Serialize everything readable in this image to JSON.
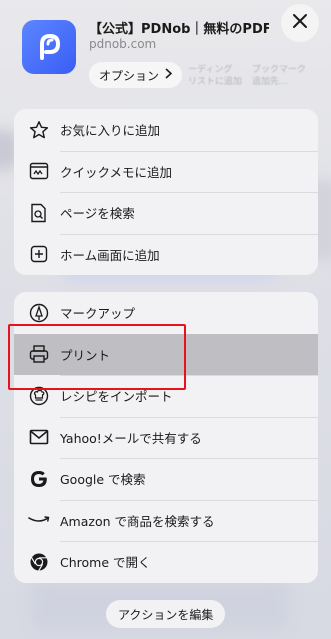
{
  "header": {
    "site_title": "【公式】PDNob｜無料のPDF編…",
    "site_url": "pdnob.com",
    "options_label": "オプション",
    "close_icon": "close-icon",
    "app_icon": "pdnob-app-icon"
  },
  "background_text": {
    "left": "ーディング\nリストに追加",
    "right": "ブックマーク\n追加先..."
  },
  "group1": {
    "items": [
      {
        "label": "お気に入りに追加",
        "icon": "star-icon"
      },
      {
        "label": "クイックメモに追加",
        "icon": "quick-note-icon"
      },
      {
        "label": "ページを検索",
        "icon": "find-on-page-icon"
      },
      {
        "label": "ホーム画面に追加",
        "icon": "add-square-icon"
      }
    ]
  },
  "group2": {
    "items": [
      {
        "label": "マークアップ",
        "icon": "markup-pen-icon"
      },
      {
        "label": "プリント",
        "icon": "printer-icon",
        "selected": true
      },
      {
        "label": "レシピをインポート",
        "icon": "chef-hat-icon"
      },
      {
        "label": "Yahoo!メールで共有する",
        "icon": "envelope-icon"
      },
      {
        "label": "Google で検索",
        "icon": "google-icon"
      },
      {
        "label": "Amazon で商品を検索する",
        "icon": "amazon-icon"
      },
      {
        "label": "Chrome で開く",
        "icon": "chrome-icon"
      }
    ]
  },
  "footer": {
    "edit_actions_label": "アクションを編集"
  },
  "colors": {
    "highlight": "#e8121c",
    "selected_row": "#bfbfc3",
    "app_icon": "#3b5df5"
  }
}
